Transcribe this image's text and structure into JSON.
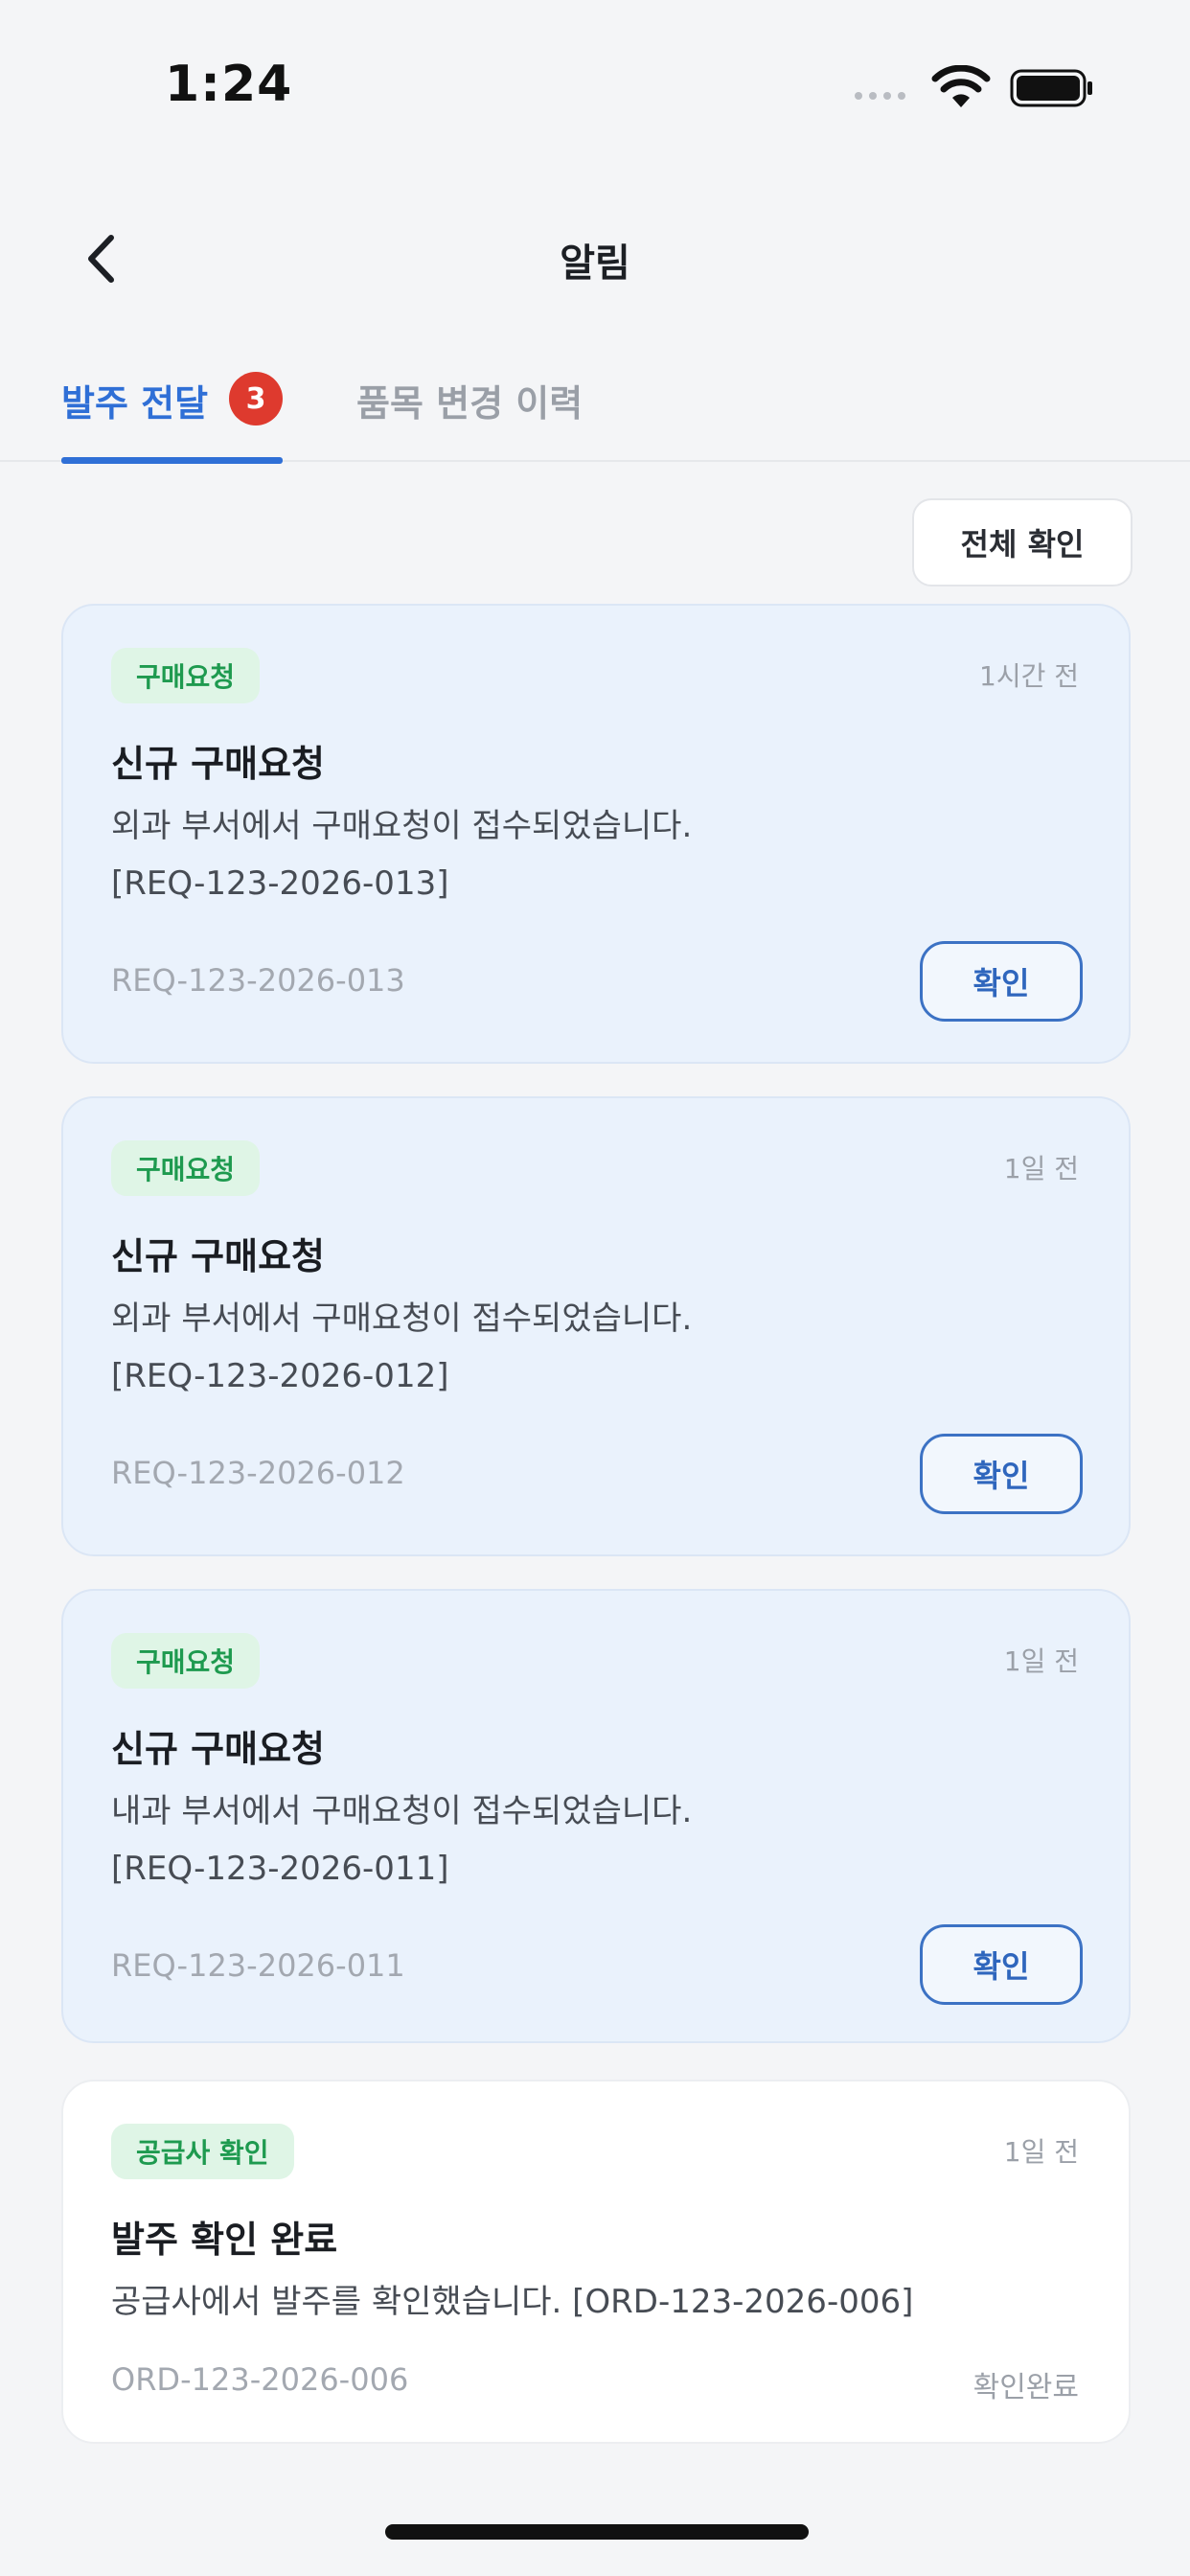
{
  "status_bar": {
    "time": "1:24"
  },
  "header": {
    "title": "알림"
  },
  "tabs": [
    {
      "label": "발주 전달",
      "badge": "3",
      "active": true
    },
    {
      "label": "품목 변경 이력",
      "active": false
    }
  ],
  "confirm_all_label": "전체 확인",
  "notifications": [
    {
      "tag": "구매요청",
      "time": "1시간 전",
      "title": "신규 구매요청",
      "message_line1": "외과 부서에서 구매요청이 접수되었습니다.",
      "message_line2": "[REQ-123-2026-013]",
      "id": "REQ-123-2026-013",
      "button": "확인"
    },
    {
      "tag": "구매요청",
      "time": "1일 전",
      "title": "신규 구매요청",
      "message_line1": "외과 부서에서 구매요청이 접수되었습니다.",
      "message_line2": "[REQ-123-2026-012]",
      "id": "REQ-123-2026-012",
      "button": "확인"
    },
    {
      "tag": "구매요청",
      "time": "1일 전",
      "title": "신규 구매요청",
      "message_line1": "내과 부서에서 구매요청이 접수되었습니다.",
      "message_line2": "[REQ-123-2026-011]",
      "id": "REQ-123-2026-011",
      "button": "확인"
    },
    {
      "tag": "공급사 확인",
      "time": "1일 전",
      "title": "발주 확인 완료",
      "message_line1": "공급사에서 발주를 확인했습니다. [ORD-123-2026-006]",
      "id": "ORD-123-2026-006",
      "status": "확인완료"
    }
  ],
  "colors": {
    "accent": "#2f6fd6",
    "badge": "#de3a2e",
    "tag_bg": "#dff5e6",
    "tag_text": "#1e9a4f",
    "unread_card_bg": "#eaf2fc"
  }
}
